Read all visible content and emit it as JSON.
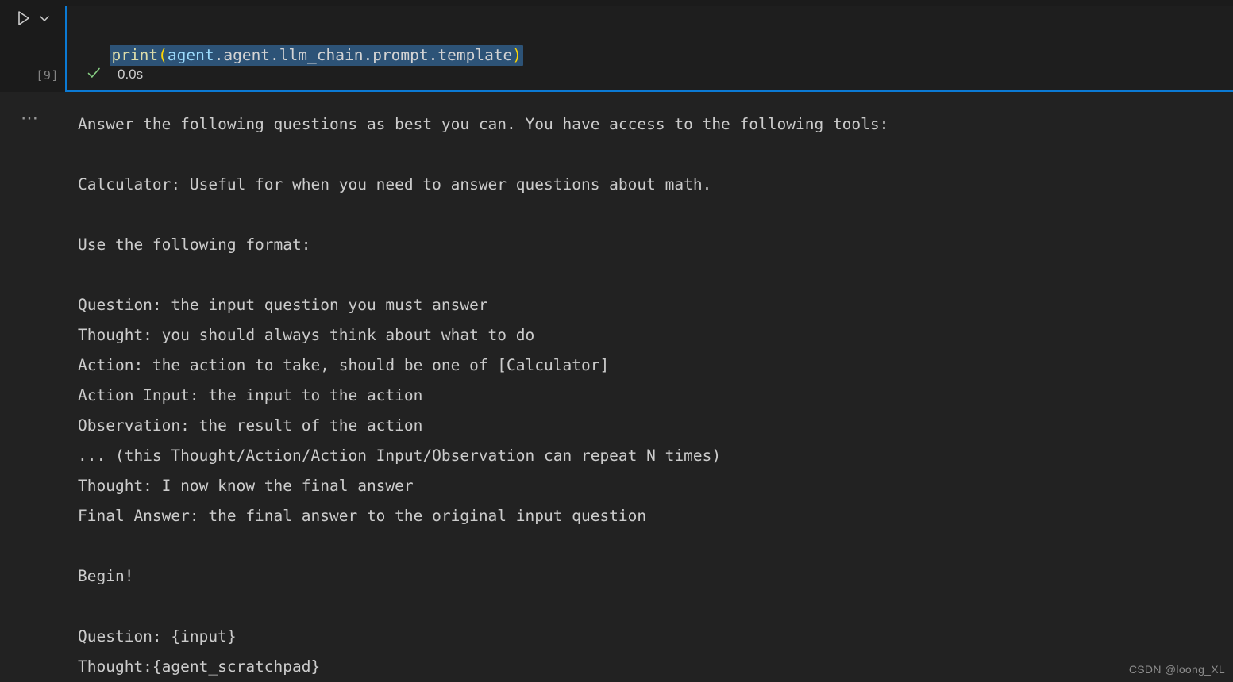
{
  "cell": {
    "run_icon": "play-triangle-icon",
    "chevron_icon": "chevron-down-icon",
    "execution_count": "[9]",
    "status_icon": "check-success-icon",
    "status_time": "0.0s",
    "code_tokens": [
      {
        "text": "print",
        "type": "function"
      },
      {
        "text": "(",
        "type": "paren"
      },
      {
        "text": "agent",
        "type": "variable"
      },
      {
        "text": ".agent.llm_chain.prompt.template",
        "type": "plain"
      },
      {
        "text": ")",
        "type": "paren"
      }
    ],
    "code_full": "print(agent.agent.llm_chain.prompt.template)",
    "selected": true
  },
  "output": {
    "more_actions_icon": "ellipsis-icon",
    "text": "Answer the following questions as best you can. You have access to the following tools:\n\nCalculator: Useful for when you need to answer questions about math.\n\nUse the following format:\n\nQuestion: the input question you must answer\nThought: you should always think about what to do\nAction: the action to take, should be one of [Calculator]\nAction Input: the input to the action\nObservation: the result of the action\n... (this Thought/Action/Action Input/Observation can repeat N times)\nThought: I now know the final answer\nFinal Answer: the final answer to the original input question\n\nBegin!\n\nQuestion: {input}\nThought:{agent_scratchpad}"
  },
  "watermark": {
    "text": "CSDN @loong_XL"
  },
  "colors": {
    "cell_focus_blue": "#0b84e0",
    "cell_border_blue": "#0b7ad4",
    "selection_blue": "#2d5377",
    "success_green": "#89d185",
    "function_yellow": "#dcdcaa",
    "paren_gold": "#ffd602",
    "variable_blue": "#9cdcfe",
    "text_gray": "#cccccc",
    "code_bg": "#1e1e1e",
    "output_bg": "#222222"
  }
}
